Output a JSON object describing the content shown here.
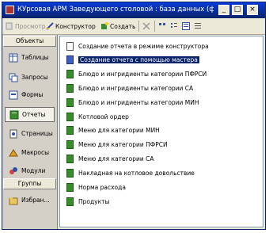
{
  "window": {
    "title": "КУрсовая АРМ Заведующего столовой : база данных (формат Ac...",
    "controls": {
      "minimize": "_",
      "maximize": "□",
      "close": "×"
    }
  },
  "toolbar": {
    "preview": "Просмотр",
    "constructor": "Конструктор",
    "create": "Создать"
  },
  "sidebar": {
    "objects_header": "Объекты",
    "items": [
      {
        "label": "Таблицы",
        "icon": "table-icon"
      },
      {
        "label": "Запросы",
        "icon": "query-icon"
      },
      {
        "label": "Формы",
        "icon": "form-icon"
      },
      {
        "label": "Отчеты",
        "icon": "report-icon",
        "selected": true
      },
      {
        "label": "Страницы",
        "icon": "page-icon"
      },
      {
        "label": "Макросы",
        "icon": "macro-icon"
      },
      {
        "label": "Модули",
        "icon": "module-icon"
      }
    ],
    "groups_header": "Группы",
    "groups": [
      {
        "label": "Избран...",
        "icon": "folder-icon"
      }
    ]
  },
  "reports": [
    {
      "label": "Создание отчета в режиме конструктора",
      "icon": "design-icon"
    },
    {
      "label": "Создание отчета с помощью мастера",
      "icon": "wizard-icon",
      "selected": true
    },
    {
      "label": "Блюдо и ингридиенты категории ПФРСИ",
      "icon": "report-icon"
    },
    {
      "label": "Блюдо и ингридиенты категории СА",
      "icon": "report-icon"
    },
    {
      "label": "Блюдо и ингридиенты категории МИН",
      "icon": "report-icon"
    },
    {
      "label": "Котловой ордер",
      "icon": "report-icon"
    },
    {
      "label": "Меню для категории МИН",
      "icon": "report-icon"
    },
    {
      "label": "Меню для категории ПФРСИ",
      "icon": "report-icon"
    },
    {
      "label": "Меню для категории СА",
      "icon": "report-icon"
    },
    {
      "label": "Накладная на котловое довольствие",
      "icon": "report-icon"
    },
    {
      "label": "Норма расхода",
      "icon": "report-icon"
    },
    {
      "label": "Продукты",
      "icon": "report-icon"
    }
  ],
  "colors": {
    "title_bar": "#0a246a",
    "selection": "#0a246a",
    "report_icon": "#3a8a2e"
  }
}
